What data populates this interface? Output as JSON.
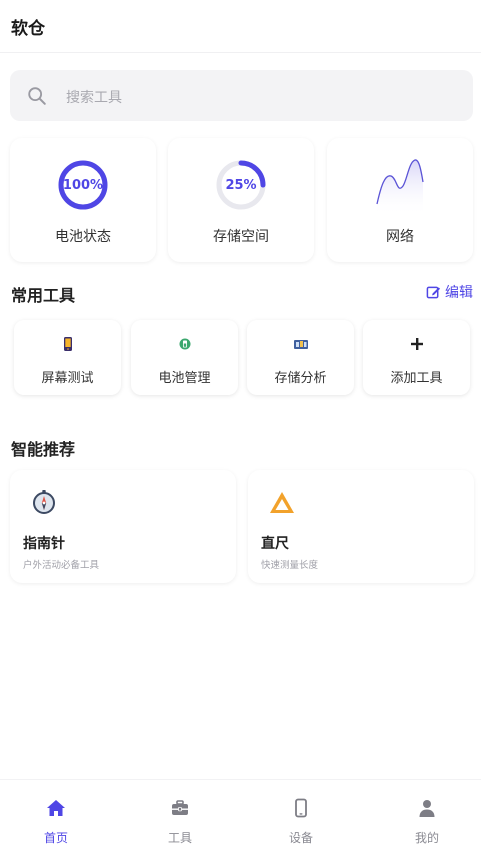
{
  "app": {
    "title": "软仓"
  },
  "search": {
    "placeholder": "搜索工具",
    "icon": "search-icon"
  },
  "stats": [
    {
      "name": "电池状态",
      "value": "100%",
      "progress": 1.0,
      "color": "#4f46e5"
    },
    {
      "name": "存储空间",
      "value": "25%",
      "progress": 0.25,
      "color": "#4f46e5"
    },
    {
      "name": "网络",
      "icon": "network-wave-icon",
      "color": "#4f46e5"
    }
  ],
  "common_tools": {
    "title": "常用工具",
    "edit_label": "编辑",
    "items": [
      {
        "label": "屏幕测试",
        "icon": "phone-screen-icon"
      },
      {
        "label": "电池管理",
        "icon": "battery-icon"
      },
      {
        "label": "存储分析",
        "icon": "storage-icon"
      },
      {
        "label": "添加工具",
        "icon": "plus-icon"
      }
    ]
  },
  "recommend": {
    "title": "智能推荐",
    "items": [
      {
        "name": "指南针",
        "desc": "户外活动必备工具",
        "icon": "compass-icon"
      },
      {
        "name": "直尺",
        "desc": "快速测量长度",
        "icon": "ruler-icon"
      }
    ]
  },
  "tabbar": {
    "items": [
      {
        "label": "首页",
        "icon": "home-icon",
        "active": true
      },
      {
        "label": "工具",
        "icon": "toolbox-icon",
        "active": false
      },
      {
        "label": "设备",
        "icon": "device-icon",
        "active": false
      },
      {
        "label": "我的",
        "icon": "user-icon",
        "active": false
      }
    ]
  },
  "colors": {
    "accent": "#4f46e5",
    "ring_track": "#e8e8ee",
    "ruler": "#f2a22b"
  }
}
